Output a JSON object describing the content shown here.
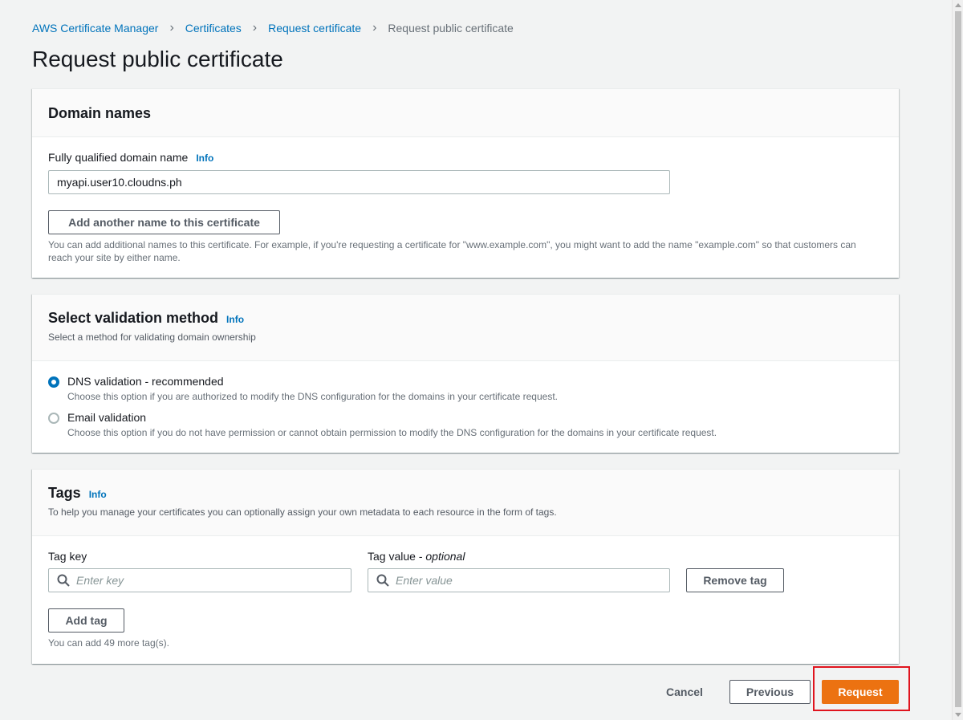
{
  "breadcrumb": {
    "items": [
      "AWS Certificate Manager",
      "Certificates",
      "Request certificate"
    ],
    "current": "Request public certificate"
  },
  "page": {
    "title": "Request public certificate"
  },
  "domain_panel": {
    "title": "Domain names",
    "fqdn_label": "Fully qualified domain name",
    "info": "Info",
    "fqdn_value": "myapi.user10.cloudns.ph",
    "add_name_button": "Add another name to this certificate",
    "hint": "You can add additional names to this certificate. For example, if you're requesting a certificate for \"www.example.com\", you might want to add the name \"example.com\" so that customers can reach your site by either name."
  },
  "validation_panel": {
    "title": "Select validation method",
    "info": "Info",
    "description": "Select a method for validating domain ownership",
    "options": [
      {
        "label": "DNS validation - recommended",
        "desc": "Choose this option if you are authorized to modify the DNS configuration for the domains in your certificate request.",
        "selected": true
      },
      {
        "label": "Email validation",
        "desc": "Choose this option if you do not have permission or cannot obtain permission to modify the DNS configuration for the domains in your certificate request.",
        "selected": false
      }
    ]
  },
  "tags_panel": {
    "title": "Tags",
    "info": "Info",
    "description": "To help you manage your certificates you can optionally assign your own metadata to each resource in the form of tags.",
    "key_label": "Tag key",
    "value_label": "Tag value",
    "value_optional": "optional",
    "key_placeholder": "Enter key",
    "value_placeholder": "Enter value",
    "remove_button": "Remove tag",
    "add_button": "Add tag",
    "hint": "You can add 49 more tag(s)."
  },
  "footer": {
    "cancel": "Cancel",
    "previous": "Previous",
    "request": "Request"
  },
  "colors": {
    "accent": "#0073bb",
    "primary": "#ec7211",
    "highlight": "#e0141e"
  }
}
